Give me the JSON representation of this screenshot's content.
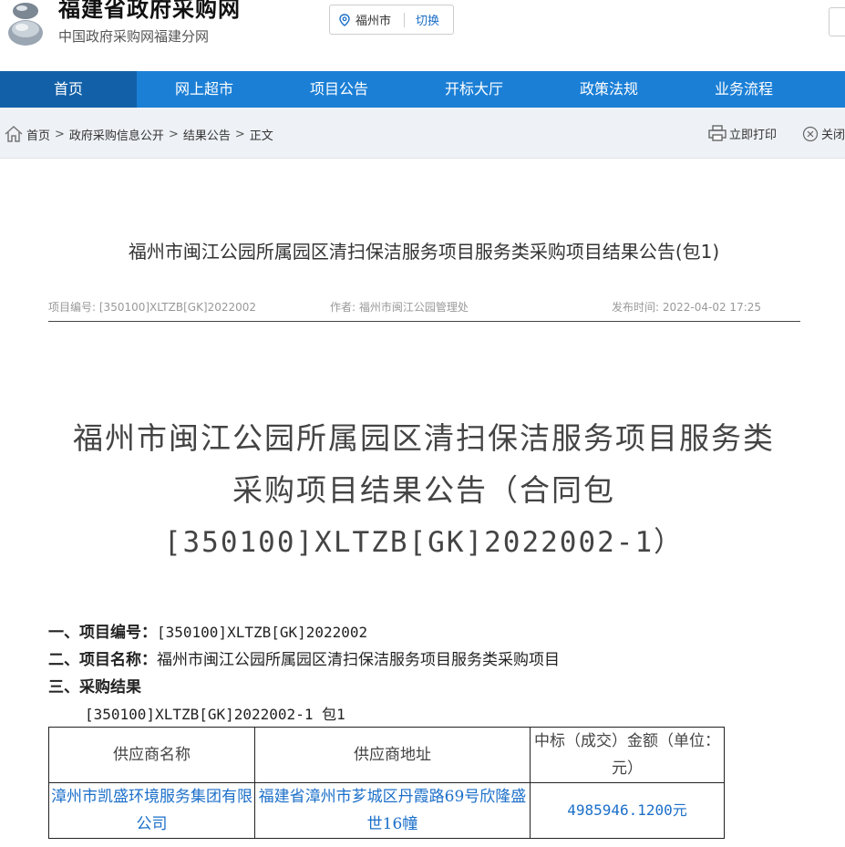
{
  "header": {
    "site_title": "福建省政府采购网",
    "site_subtitle": "中国政府采购网福建分网",
    "city": "福州市",
    "city_switch": "切换"
  },
  "nav": {
    "items": [
      "首页",
      "网上超市",
      "项目公告",
      "开标大厅",
      "政策法规",
      "业务流程"
    ],
    "active": "首页"
  },
  "breadcrumb": {
    "items": [
      "首页",
      "政府采购信息公开",
      "结果公告",
      "正文"
    ],
    "separator": ">"
  },
  "actions": {
    "print": "立即打印",
    "close": "关闭"
  },
  "article": {
    "title": "福州市闽江公园所属园区清扫保洁服务项目服务类采购项目结果公告(包1)",
    "meta": {
      "project_no_label": "项目编号:",
      "project_no": "[350100]XLTZB[GK]2022002",
      "author_label": "作者:",
      "author": "福州市闽江公园管理处",
      "publish_label": "发布时间:",
      "publish_time": "2022-04-02 17:25"
    }
  },
  "document": {
    "title_lines": [
      "福州市闽江公园所属园区清扫保洁服务项目服务类",
      "采购项目结果公告（合同包",
      "[350100]XLTZB[GK]2022002-1）"
    ],
    "sections": {
      "s1_label": "一、项目编号：",
      "s1_value": "[350100]XLTZB[GK]2022002",
      "s2_label": "二、项目名称：",
      "s2_value": "福州市闽江公园所属园区清扫保洁服务项目服务类采购项目",
      "s3_label": "三、采购结果",
      "package_line": "[350100]XLTZB[GK]2022002-1 包1"
    },
    "table": {
      "headers": [
        "供应商名称",
        "供应商地址",
        "中标（成交）金额（单位：元）"
      ],
      "rows": [
        [
          "漳州市凯盛环境服务集团有限公司",
          "福建省漳州市芗城区丹霞路69号欣隆盛世16幢",
          "4985946.1200元"
        ]
      ]
    }
  }
}
